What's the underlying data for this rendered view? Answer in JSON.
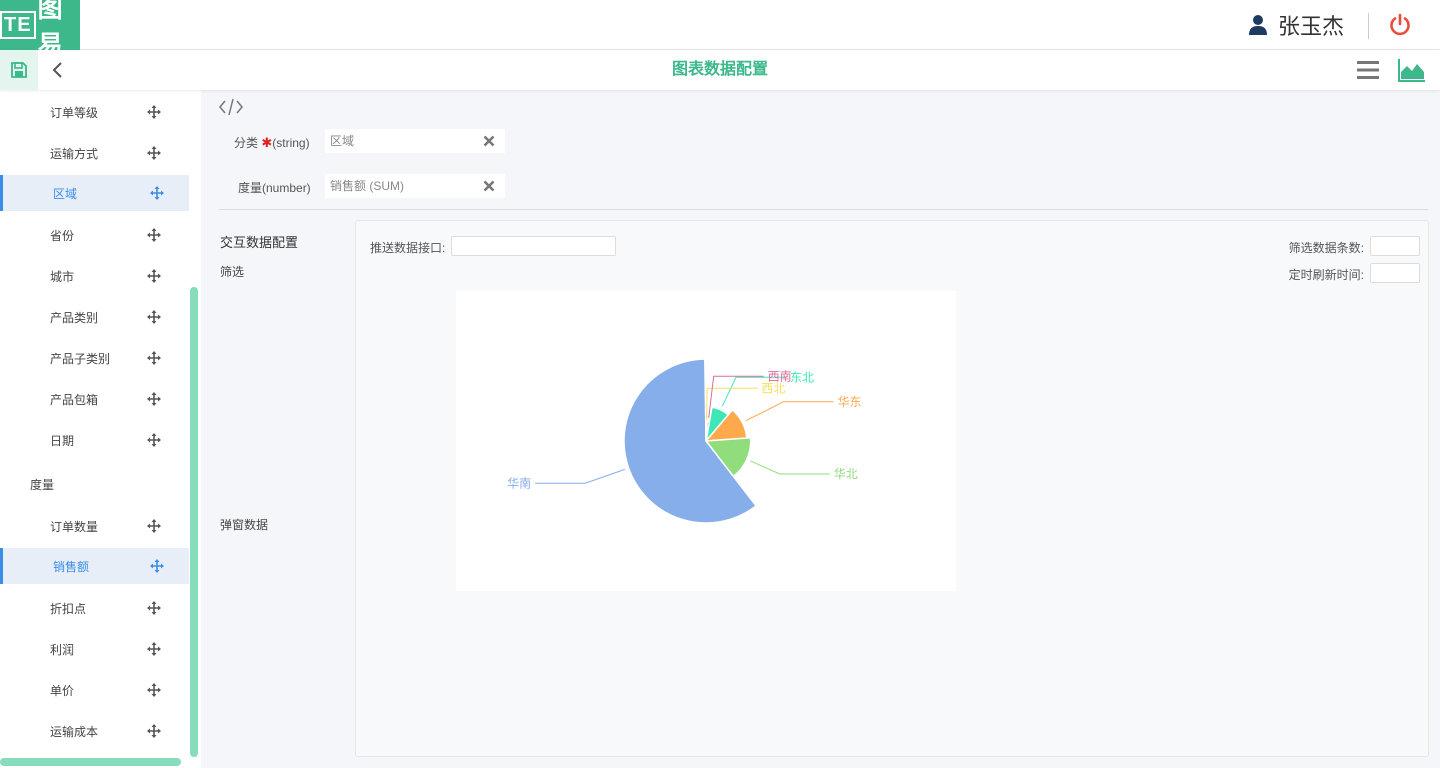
{
  "header": {
    "logo_text": "图易",
    "logo_mark": "TE",
    "user_name": "张玉杰"
  },
  "toolbar": {
    "title": "图表数据配置"
  },
  "sidebar": {
    "dimension_items": [
      {
        "label": "订单等级"
      },
      {
        "label": "运输方式"
      },
      {
        "label": "区域",
        "active": true
      },
      {
        "label": "省份"
      },
      {
        "label": "城市"
      },
      {
        "label": "产品类别"
      },
      {
        "label": "产品子类别"
      },
      {
        "label": "产品包箱"
      },
      {
        "label": "日期"
      }
    ],
    "measure_group": "度量",
    "measure_items": [
      {
        "label": "订单数量"
      },
      {
        "label": "销售额",
        "active": true
      },
      {
        "label": "折扣点"
      },
      {
        "label": "利润"
      },
      {
        "label": "单价"
      },
      {
        "label": "运输成本"
      }
    ]
  },
  "config": {
    "category_label": "分类",
    "category_required": "✱",
    "category_type": "(string)",
    "category_value": "区域",
    "measure_label": "度量(number)",
    "measure_value": "销售额 (SUM)"
  },
  "interaction": {
    "title": "交互数据配置",
    "filter_label": "筛选",
    "popup_label": "弹窗数据",
    "push_api_label": "推送数据接口:",
    "push_api_value": "",
    "filter_count_label": "筛选数据条数:",
    "filter_count_value": "",
    "refresh_time_label": "定时刷新时间:",
    "refresh_time_value": ""
  },
  "colors": {
    "brand": "#3cb88a",
    "active_blue": "#3a8ee6",
    "danger": "#e74c3c"
  },
  "chart_data": {
    "type": "pie",
    "subtype": "rose",
    "series": [
      {
        "name": "东北",
        "value": 14,
        "color": "#3ee8b6"
      },
      {
        "name": "华东",
        "value": 21,
        "color": "#ffa94d"
      },
      {
        "name": "华北",
        "value": 26,
        "color": "#91dc7d"
      },
      {
        "name": "华南",
        "value": 100,
        "color": "#86aeea"
      },
      {
        "name": "西北",
        "value": 2,
        "color": "#f7e05b"
      },
      {
        "name": "西南",
        "value": 3,
        "color": "#dd6b9a"
      }
    ]
  }
}
